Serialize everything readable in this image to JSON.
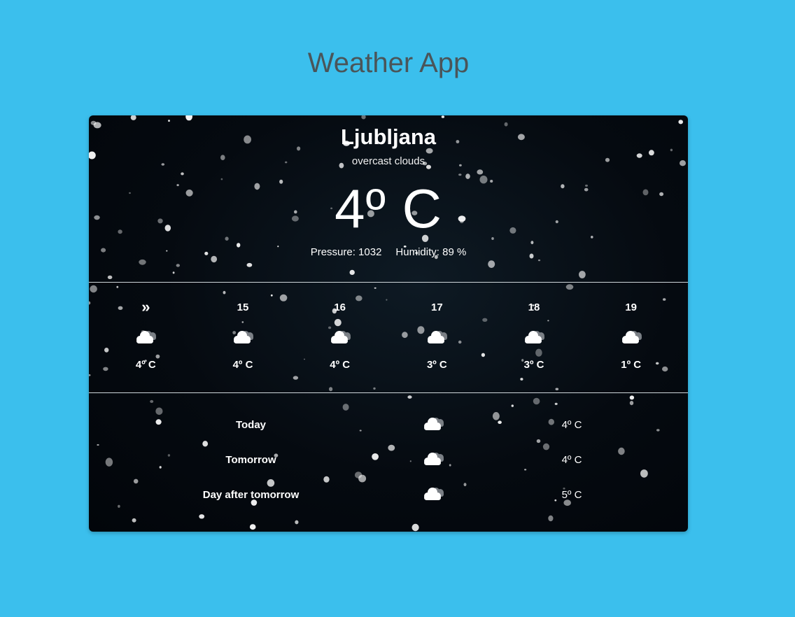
{
  "app": {
    "title": "Weather App"
  },
  "current": {
    "city": "Ljubljana",
    "description": "overcast clouds",
    "temperature": "4º C",
    "pressure": "Pressure: 1032",
    "humidity": "Humidity: 89 %"
  },
  "hourly": [
    {
      "label": "»",
      "icon": "cloud-icon",
      "temp": "4º C"
    },
    {
      "label": "15",
      "icon": "cloud-icon",
      "temp": "4º C"
    },
    {
      "label": "16",
      "icon": "cloud-icon",
      "temp": "4º C"
    },
    {
      "label": "17",
      "icon": "cloud-icon",
      "temp": "3º C"
    },
    {
      "label": "18",
      "icon": "cloud-icon",
      "temp": "3º C"
    },
    {
      "label": "19",
      "icon": "cloud-icon",
      "temp": "1º C"
    }
  ],
  "daily": [
    {
      "day": "Today",
      "icon": "cloud-icon",
      "temp": "4º C"
    },
    {
      "day": "Tomorrow",
      "icon": "cloud-icon",
      "temp": "4º C"
    },
    {
      "day": "Day after tomorrow",
      "icon": "cloud-icon",
      "temp": "5º C"
    }
  ],
  "colors": {
    "background": "#3bbfed",
    "title": "#4a5559",
    "card": "#050a10",
    "text": "#ffffff"
  }
}
